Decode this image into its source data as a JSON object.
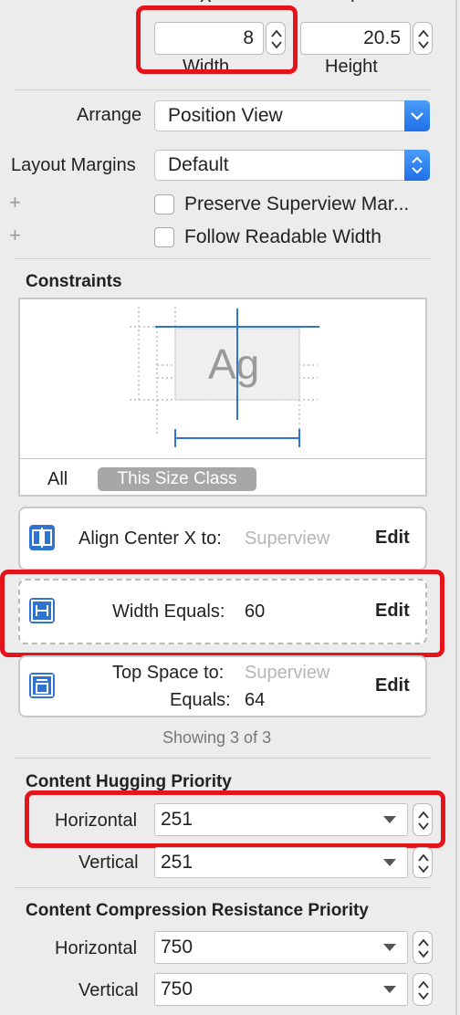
{
  "size": {
    "x_label": "X",
    "y_label": "Y",
    "width_value": "8",
    "height_value": "20.5",
    "width_label": "Width",
    "height_label": "Height"
  },
  "arrange": {
    "label": "Arrange",
    "value": "Position View"
  },
  "layout_margins": {
    "label": "Layout Margins",
    "value": "Default"
  },
  "options": {
    "preserve_superview": "Preserve Superview Mar...",
    "follow_readable": "Follow Readable Width"
  },
  "constraints": {
    "title": "Constraints",
    "preview_text": "Ag",
    "filter_all": "All",
    "filter_size_class": "This Size Class",
    "items": [
      {
        "label": "Align Center X to:",
        "target": "Superview",
        "edit": "Edit",
        "icon": "align-center-x-icon"
      },
      {
        "label": "Width Equals:",
        "value": "60",
        "edit": "Edit",
        "icon": "width-constraint-icon"
      },
      {
        "label": "Top Space to:",
        "target": "Superview",
        "label2": "Equals:",
        "value": "64",
        "edit": "Edit",
        "icon": "top-space-icon"
      }
    ],
    "showing": "Showing 3 of 3"
  },
  "hugging": {
    "title": "Content Hugging Priority",
    "horizontal_label": "Horizontal",
    "horizontal_value": "251",
    "vertical_label": "Vertical",
    "vertical_value": "251"
  },
  "compression": {
    "title": "Content Compression Resistance Priority",
    "horizontal_label": "Horizontal",
    "horizontal_value": "750",
    "vertical_label": "Vertical",
    "vertical_value": "750"
  },
  "colors": {
    "accent": "#2f74d0",
    "highlight": "#e5141b",
    "panel": "#ececec"
  }
}
